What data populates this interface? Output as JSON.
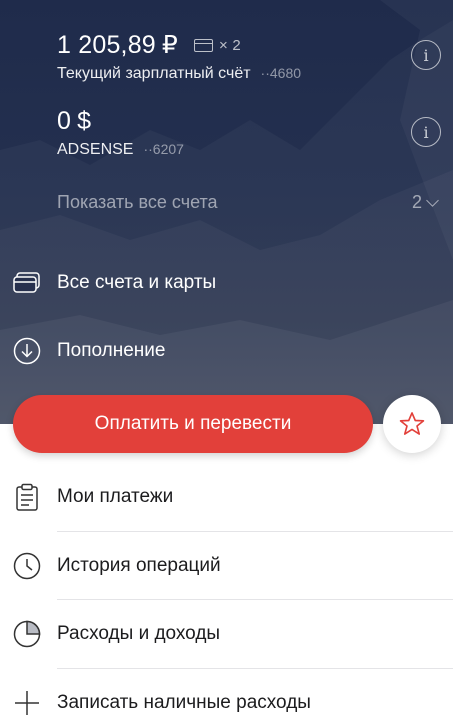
{
  "accounts": [
    {
      "amount": "1 205,89",
      "currency": "₽",
      "cards_count": "× 2",
      "name": "Текущий зарплатный счёт",
      "mask": "··4680",
      "info_icon": "info-icon"
    },
    {
      "amount": "0",
      "currency": "$",
      "name": "ADSENSE",
      "mask": "··6207",
      "info_icon": "info-icon"
    }
  ],
  "show_all": {
    "label": "Показать все счета",
    "count": "2"
  },
  "hero_actions": [
    {
      "label": "Все счета и карты",
      "icon": "cards-icon"
    },
    {
      "label": "Пополнение",
      "icon": "download-circle-icon"
    }
  ],
  "pay_button": {
    "label": "Оплатить и перевести"
  },
  "favorite_button": {
    "icon": "star-icon"
  },
  "menu": [
    {
      "label": "Мои платежи",
      "icon": "clipboard-icon"
    },
    {
      "label": "История операций",
      "icon": "clock-icon"
    },
    {
      "label": "Расходы и доходы",
      "icon": "pie-chart-icon"
    },
    {
      "label": "Записать наличные расходы",
      "icon": "plus-icon"
    }
  ],
  "colors": {
    "hero_bg": "#1f2b4b",
    "accent_red": "#e2403a",
    "text_dark": "#1c1c1e"
  }
}
